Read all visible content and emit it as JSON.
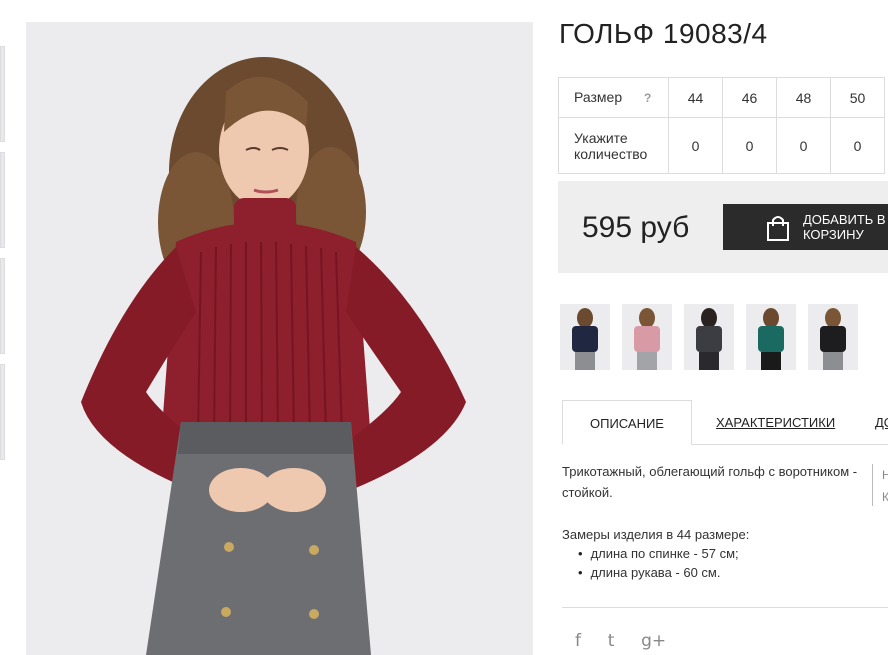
{
  "product": {
    "title": "ГОЛЬФ 19083/4"
  },
  "size_table": {
    "size_label": "Размер",
    "help_icon": "?",
    "sizes": [
      "44",
      "46",
      "48",
      "50"
    ],
    "qty_label": "Укажите количество",
    "quantities": [
      "0",
      "0",
      "0",
      "0"
    ]
  },
  "purchase": {
    "price": "595 руб",
    "add_button": "ДОБАВИТЬ В КОРЗИНУ",
    "bag_icon": "shopping-bag-icon"
  },
  "colors": {
    "swatches": [
      "navy",
      "pink",
      "dark-grey",
      "teal",
      "black"
    ]
  },
  "tabs": {
    "description": "ОПИСАНИЕ",
    "specs": "ХАРАКТЕРИСТИКИ",
    "more": "ДО"
  },
  "description": {
    "text": "Трикотажный, облегающий гольф с воротником - стойкой.",
    "measures_title": "Замеры изделия в 44 размере:",
    "measures": [
      "длина по спинке - 57 см;",
      "длина рукава - 60 см."
    ],
    "side_note": "Н К"
  },
  "social": {
    "facebook": "f",
    "twitter": "t",
    "googleplus": "g+"
  },
  "theme": {
    "accent": "#2b2b2b",
    "sweater": "#8e1f2c",
    "price_bg": "#eeeeee"
  }
}
